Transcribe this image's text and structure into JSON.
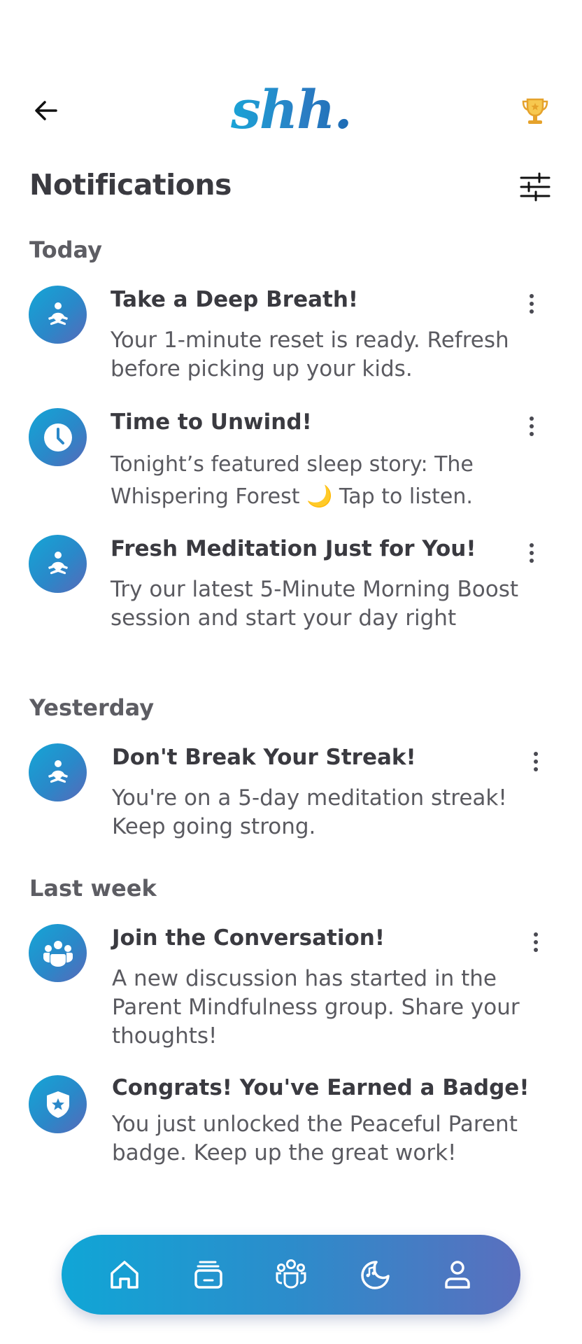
{
  "header": {
    "logo_text": "shh.",
    "page_title": "Notifications"
  },
  "sections": [
    {
      "label": "Today"
    },
    {
      "label": "Yesterday"
    },
    {
      "label": "Last week"
    }
  ],
  "notifications": [
    {
      "title": "Take a Deep Breath!",
      "body": "Your 1-minute reset is ready. Refresh before picking up your kids.",
      "icon": "meditation-icon"
    },
    {
      "title": "Time to Unwind!",
      "body": "Tonight’s featured sleep story: The Whispering Forest 🌙 Tap to listen.",
      "icon": "clock-icon"
    },
    {
      "title": "Fresh Meditation Just for You!",
      "body": "Try our latest 5-Minute Morning Boost session and start your day right",
      "icon": "meditation-icon"
    },
    {
      "title": "Don't Break Your Streak!",
      "body": "You're on a 5-day meditation streak! Keep going strong.",
      "icon": "meditation-icon"
    },
    {
      "title": "Join the Conversation!",
      "body": "A new discussion has started in the Parent Mindfulness group. Share your thoughts!",
      "icon": "community-icon"
    },
    {
      "title": "Congrats! You've Earned a Badge!",
      "body": "You just unlocked the Peaceful Parent badge. Keep up the great work!",
      "icon": "badge-icon"
    }
  ],
  "nav": [
    {
      "icon": "home-icon"
    },
    {
      "icon": "library-icon"
    },
    {
      "icon": "community-icon"
    },
    {
      "icon": "sleep-icon"
    },
    {
      "icon": "profile-icon"
    }
  ],
  "colors": {
    "accent_start": "#10a6d6",
    "accent_end": "#5a6fbe",
    "trophy": "#f0b43a",
    "text_primary": "#3a3a40",
    "text_secondary": "#5a5a60"
  }
}
